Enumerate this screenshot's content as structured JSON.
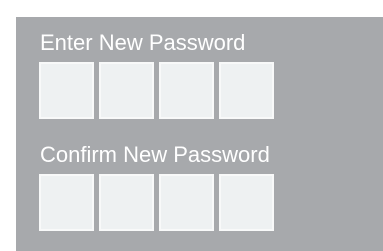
{
  "colors": {
    "panel_background": "#a7a9ac",
    "label_text": "#ffffff",
    "input_background": "#eef1f2"
  },
  "new_password": {
    "label": "Enter New Password",
    "digits": [
      "",
      "",
      "",
      ""
    ]
  },
  "confirm_password": {
    "label": "Confirm New Password",
    "digits": [
      "",
      "",
      "",
      ""
    ]
  }
}
